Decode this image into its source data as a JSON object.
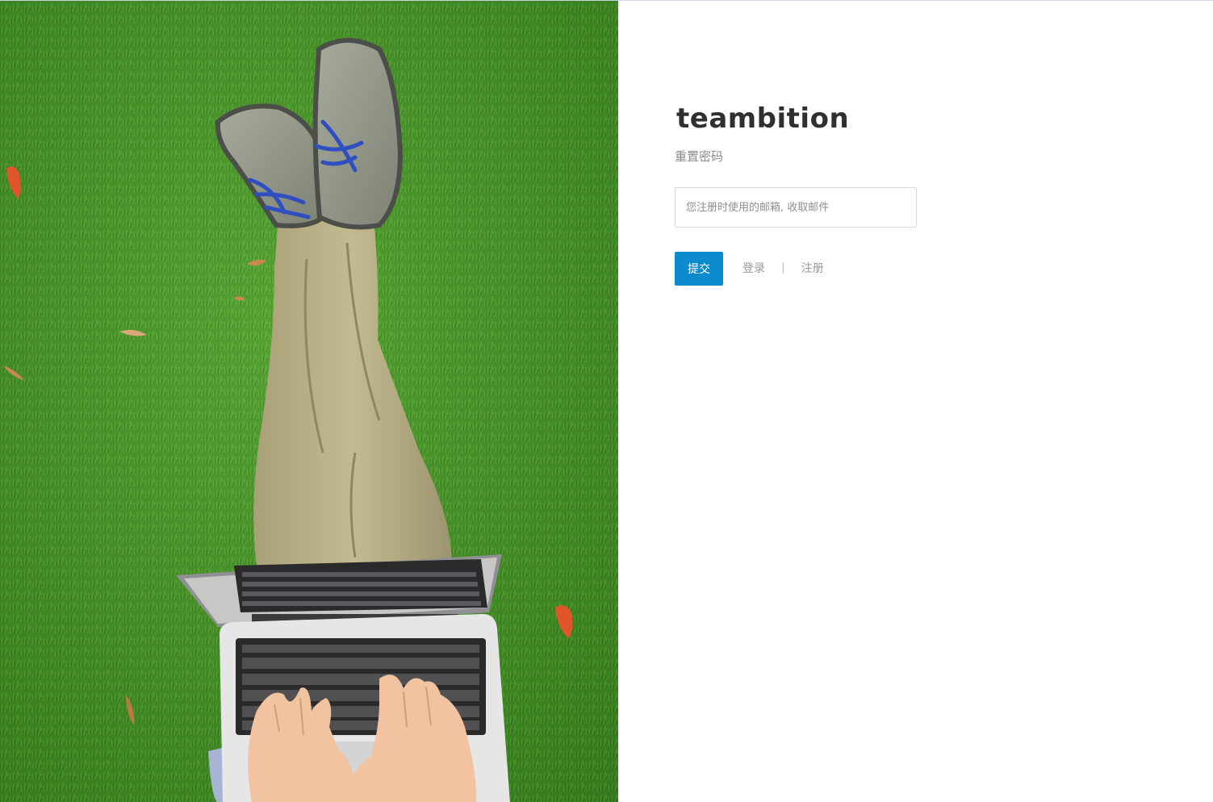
{
  "brand": {
    "name": "teambition"
  },
  "form": {
    "subtitle": "重置密码",
    "email_placeholder": "您注册时使用的邮箱, 收取邮件",
    "email_value": "",
    "submit_label": "提交"
  },
  "links": {
    "login_label": "登录",
    "divider": "|",
    "register_label": "注册"
  },
  "colors": {
    "accent": "#0c8ace",
    "grass": "#3f8a23",
    "text_muted": "#8c8c8c"
  },
  "photo": {
    "subject": "person-sitting-on-grass-with-laptop"
  }
}
